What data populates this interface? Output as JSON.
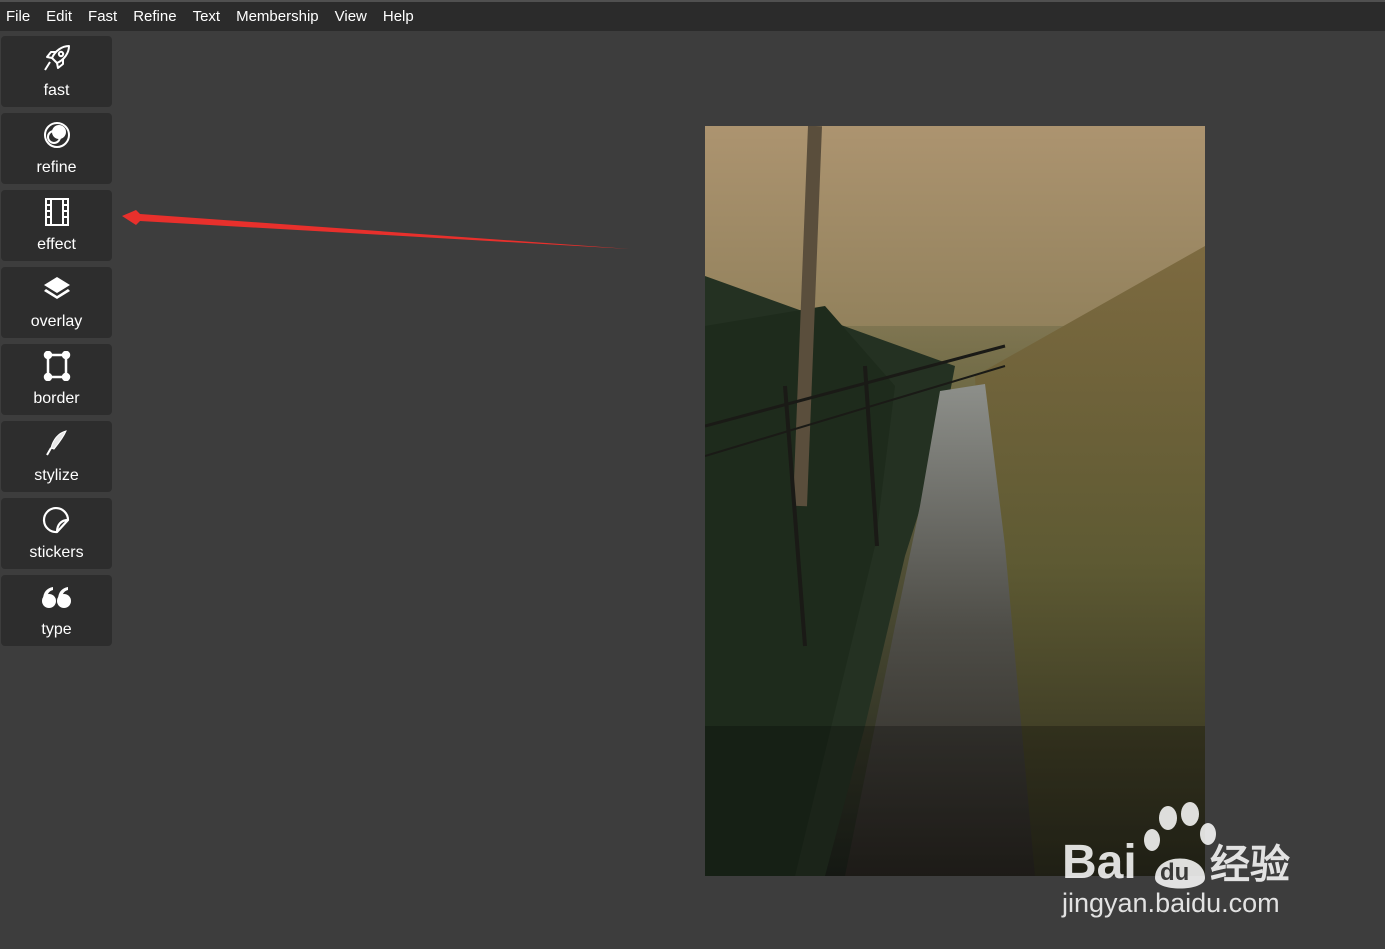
{
  "menu": [
    "File",
    "Edit",
    "Fast",
    "Refine",
    "Text",
    "Membership",
    "View",
    "Help"
  ],
  "tools": [
    {
      "label": "fast",
      "icon": "rocket-icon"
    },
    {
      "label": "refine",
      "icon": "refine-circles-icon"
    },
    {
      "label": "effect",
      "icon": "film-strip-icon"
    },
    {
      "label": "overlay",
      "icon": "layers-icon"
    },
    {
      "label": "border",
      "icon": "frame-icon"
    },
    {
      "label": "stylize",
      "icon": "feather-icon"
    },
    {
      "label": "stickers",
      "icon": "sticker-icon"
    },
    {
      "label": "type",
      "icon": "quote-icon"
    }
  ],
  "watermark": {
    "brand": "Bai",
    "brand2": "du",
    "cn": "经验",
    "url": "jingyan.baidu.com"
  },
  "colors": {
    "background": "#3d3d3d",
    "menubar": "#2b2b2b",
    "tool_button": "#2d2d2d",
    "arrow": "#e8302c"
  }
}
